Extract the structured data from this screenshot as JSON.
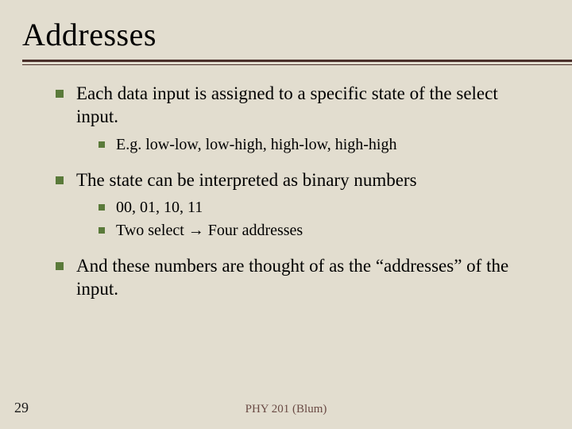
{
  "title": "Addresses",
  "bullets": [
    {
      "text": "Each data input is assigned to a specific state of the select input.",
      "sub": [
        "E.g. low-low, low-high, high-low, high-high"
      ]
    },
    {
      "text": "The state can be interpreted as binary numbers",
      "sub": [
        "00, 01, 10, 11",
        "Two select → Four addresses"
      ]
    },
    {
      "text": "And these numbers are thought of as the “addresses” of the input.",
      "sub": []
    }
  ],
  "pageNumber": "29",
  "footer": "PHY 201 (Blum)"
}
